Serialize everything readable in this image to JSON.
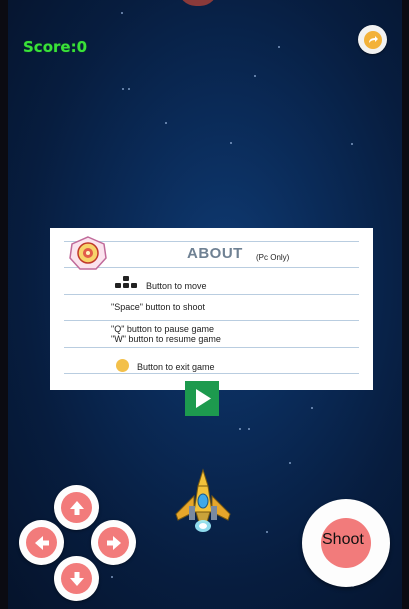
{
  "game": {
    "score": "Score:0"
  },
  "about": {
    "title": "ABOUT",
    "note": "(Pc Only)",
    "move": "Button to move",
    "shoot": "\"Space\" button to shoot",
    "pause": "\"Q\" button to pause game",
    "resume": "\"W\" button to resume game",
    "exit": "Button to exit game"
  },
  "controls": {
    "shoot_label": "Shoot",
    "play_icon": "play-icon",
    "exit_icon": "exit-icon",
    "up_icon": "arrow-up-icon",
    "down_icon": "arrow-down-icon",
    "left_icon": "arrow-left-icon",
    "right_icon": "arrow-right-icon"
  },
  "colors": {
    "score": "#39e239",
    "control_red": "#f27b7b",
    "play_green": "#1d9a4e",
    "exit_orange": "#f3b23a"
  }
}
